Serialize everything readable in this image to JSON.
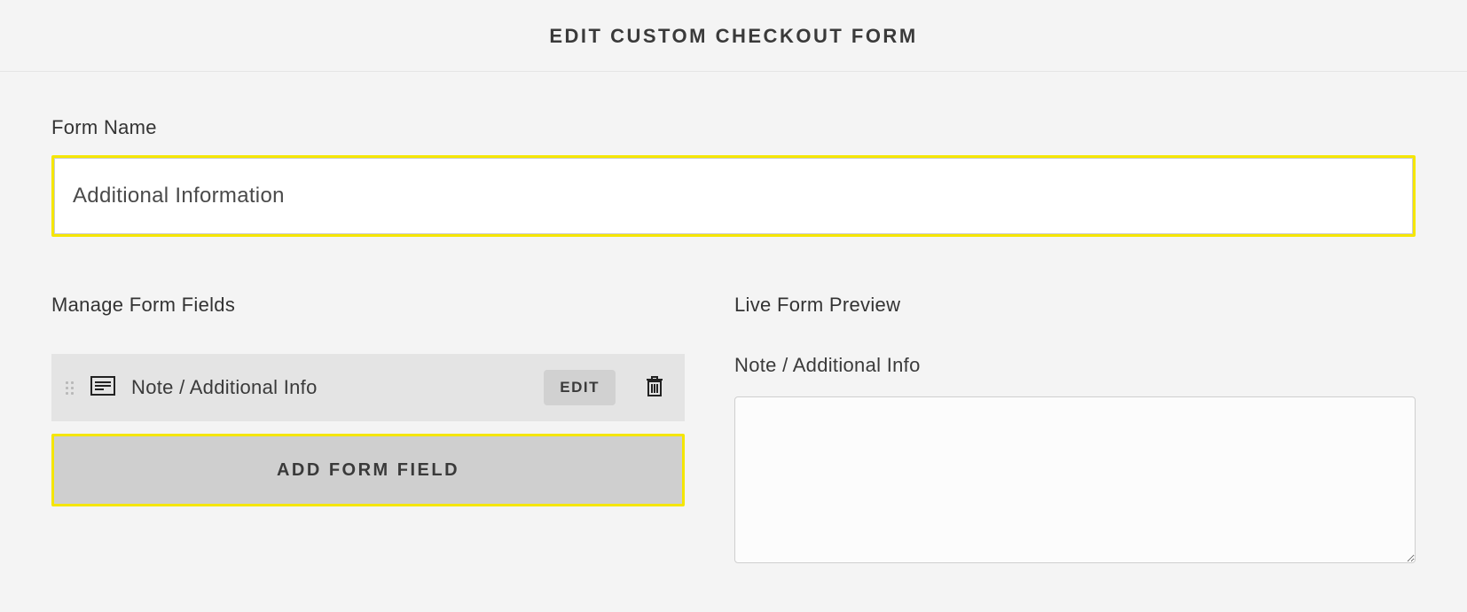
{
  "header": {
    "title": "EDIT CUSTOM CHECKOUT FORM"
  },
  "form_name": {
    "label": "Form Name",
    "value": "Additional Information"
  },
  "manage": {
    "heading": "Manage Form Fields",
    "fields": [
      {
        "label": "Note / Additional Info",
        "edit_label": "EDIT"
      }
    ],
    "add_label": "ADD FORM FIELD"
  },
  "preview": {
    "heading": "Live Form Preview",
    "field_label": "Note / Additional Info",
    "value": ""
  },
  "colors": {
    "highlight": "#f5e600"
  }
}
